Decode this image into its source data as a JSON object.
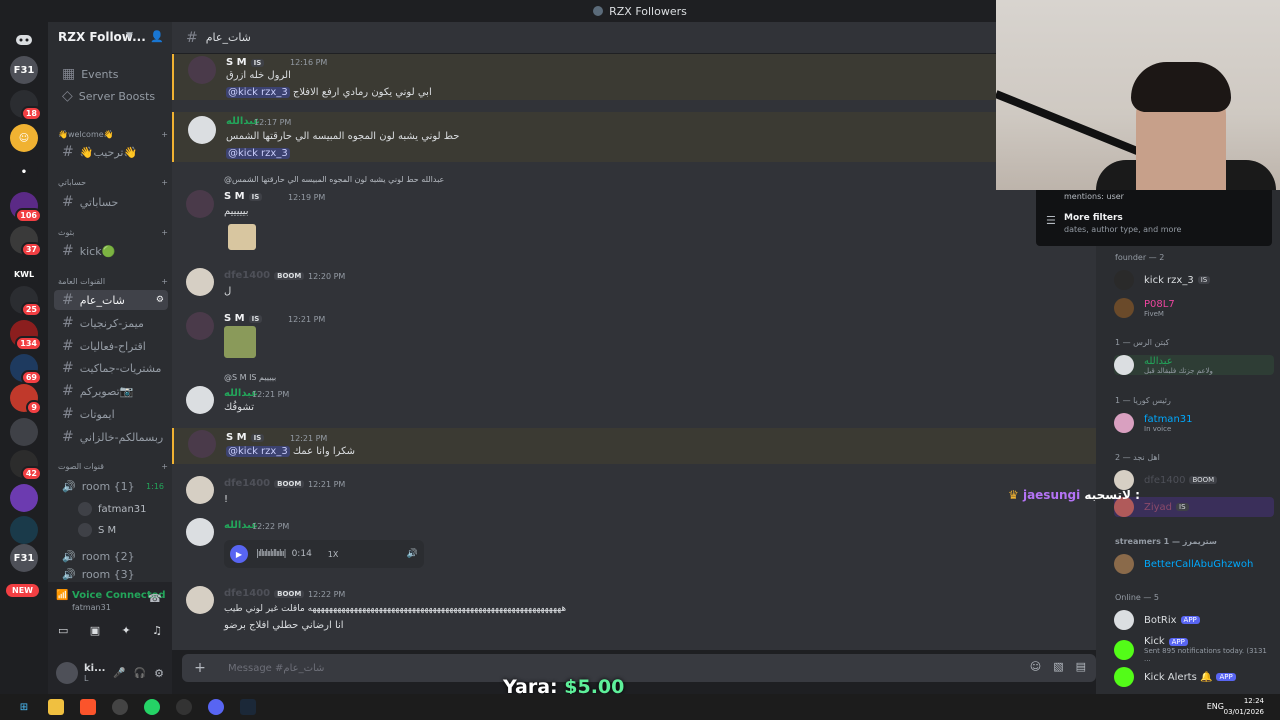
{
  "window": {
    "title": "RZX Followers"
  },
  "server": {
    "name": "RZX Follow..."
  },
  "rail_badges": [
    "18",
    "106",
    "37",
    "25",
    "134",
    "69",
    "9",
    "42"
  ],
  "rail_new": "NEW",
  "sidebar": {
    "top": [
      {
        "label": "Events"
      },
      {
        "label": "Server Boosts"
      }
    ],
    "categories": [
      {
        "label": "👋welcome👋"
      },
      {
        "label": "حساباتي"
      },
      {
        "label": "بثوث"
      },
      {
        "label": "القنوات العامة"
      },
      {
        "label": "قنوات الصوت"
      }
    ],
    "channels": [
      {
        "label": "👋ترحيب👋"
      },
      {
        "label": "حساباتي"
      },
      {
        "label": "kick🟢"
      },
      {
        "label": "شات_عام"
      },
      {
        "label": "ميمز-كرنجيات"
      },
      {
        "label": "اقتراح-فعاليات"
      },
      {
        "label": "مشتريات-جماكيت"
      },
      {
        "label": "تصويركم📷"
      },
      {
        "label": "ايموتات"
      },
      {
        "label": "ربسمالكم-خالزاني"
      }
    ],
    "voice": [
      {
        "label": "room {1}",
        "time": "1:16"
      },
      {
        "label": "room {2}"
      },
      {
        "label": "room {3}"
      }
    ],
    "voice_users": [
      "fatman31",
      "S M"
    ],
    "vc_status": "Voice Connected",
    "vc_user": "fatman31",
    "user_short": "ki...",
    "user_sub": "L"
  },
  "chat": {
    "channel": "شات_عام",
    "composer_placeholder": "Message #شات_عام",
    "messages": [
      {
        "name": "S M",
        "tag": "IS",
        "time": "12:16 PM",
        "line1": "الرول خله ازرق",
        "line2_mention": "@kick rzx_3",
        "line2": "ابي لوني يكون رمادي ارفع الافلاج"
      },
      {
        "name": "عبدالله",
        "time": "12:17 PM",
        "line1": "حط لوني يشبه لون المجوه المبيسه الي حارقتها الشمس",
        "line2_mention": "@kick rzx_3"
      },
      {
        "reply": "@عبدالله حط لوني يشبه لون المجوه المبيسه الي حارقتها الشمس",
        "name": "S M",
        "tag": "IS",
        "time": "12:19 PM",
        "line1": "بيييييم"
      },
      {
        "name": "dfe1400",
        "tag": "BOOM",
        "time": "12:20 PM",
        "line1": "ل"
      },
      {
        "name": "S M",
        "tag": "IS",
        "time": "12:21 PM"
      },
      {
        "reply": "@S M IS بييييم",
        "name": "عبدالله",
        "time": "12:21 PM",
        "line1": "تشوفُك"
      },
      {
        "name": "S M",
        "tag": "IS",
        "time": "12:21 PM",
        "line1_mention": "@kick rzx_3",
        "line1": "شكرا وانا عمك"
      },
      {
        "name": "dfe1400",
        "tag": "BOOM",
        "time": "12:21 PM",
        "line1": "!"
      },
      {
        "name": "عبدالله",
        "time": "12:22 PM",
        "audio_time": "0:14",
        "audio_speed": "1X"
      },
      {
        "name": "dfe1400",
        "tag": "BOOM",
        "time": "12:22 PM",
        "line1": "هههههههههههههههههههههههههههههههههههههههههههههههههههههههههههههه ماقلت غير لوني طيب",
        "line2": "انا ارضاني حطلي افلاج برضو"
      }
    ]
  },
  "search_popup": {
    "mentions": "mentions: user",
    "filters_title": "More filters",
    "filters_sub": "dates, author type, and more"
  },
  "members": {
    "groups": [
      {
        "label": "founder — 2",
        "members": [
          {
            "name": "kick rzx_3",
            "tag": "IS"
          },
          {
            "name": "P08L7",
            "sub": "FiveM"
          }
        ]
      },
      {
        "label": "كبتن الرس — 1",
        "members": [
          {
            "name": "عبدالله",
            "sub": "ولاعم جزتك فلبقالد قبل"
          }
        ]
      },
      {
        "label": "رئيس كوريا — 1",
        "members": [
          {
            "name": "fatman31",
            "sub": "In voice"
          }
        ]
      },
      {
        "label": "اهل نجد — 2",
        "members": [
          {
            "name": "dfe1400",
            "tag": "BOOM"
          },
          {
            "name": "Ziyad",
            "tag": "IS"
          }
        ]
      },
      {
        "label": "streamers ستريمرز — 1",
        "members": [
          {
            "name": "BetterCallAbuGhzwoh"
          }
        ]
      },
      {
        "label": "Online — 5",
        "members": [
          {
            "name": "BotRix",
            "tag": "APP"
          },
          {
            "name": "Kick",
            "tag": "APP",
            "sub": "Sent 895 notifications today. (3131 ..."
          },
          {
            "name": "Kick Alerts 🔔",
            "tag": "APP"
          }
        ]
      }
    ]
  },
  "overlay": {
    "user": "jaesungi",
    "text": "لاتسحبه :",
    "donation_name": "Yara:",
    "donation_amount": "$5.00"
  },
  "taskbar": {
    "lang": "ENG",
    "time": "12:24",
    "date": "03/01/2026"
  },
  "colors": {
    "accent": "#5865f2",
    "green": "#23a55a",
    "mention_bg": "#3c4270",
    "highlight_border": "#f0b232",
    "fivem_pink": "#eb459e",
    "member_link": "#00a8fc",
    "overlay_name": "#b473f5"
  }
}
